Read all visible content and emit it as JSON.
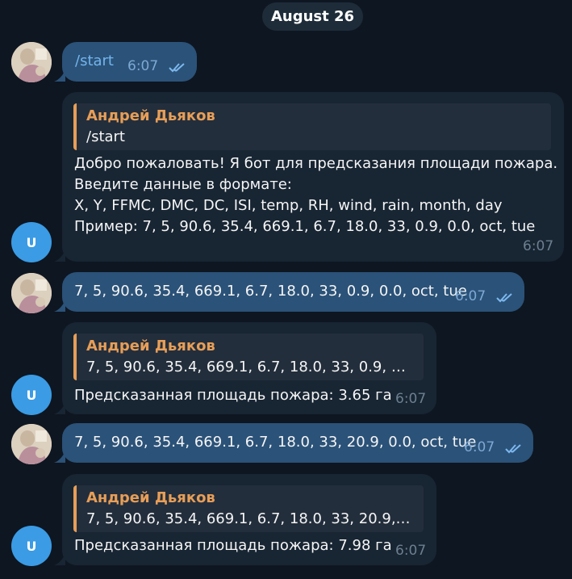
{
  "date_separator": "August 26",
  "messages": [
    {
      "text": "/start",
      "time": "6:07"
    },
    {
      "quote_author": "Андрей Дьяков",
      "quote_text": "/start",
      "lines": [
        "Добро пожаловать! Я бот для предсказания площади пожара.",
        "Введите данные в формате:",
        "X, Y, FFMC, DMC, DC, ISI, temp, RH, wind, rain, month, day",
        "Пример: 7, 5, 90.6, 35.4, 669.1, 6.7, 18.0, 33, 0.9, 0.0, oct, tue"
      ],
      "time": "6:07",
      "avatar_letter": "U"
    },
    {
      "text": "7, 5, 90.6, 35.4, 669.1, 6.7, 18.0, 33, 0.9, 0.0, oct, tue",
      "time": "6:07"
    },
    {
      "quote_author": "Андрей Дьяков",
      "quote_text": "7, 5, 90.6, 35.4, 669.1, 6.7, 18.0, 33, 0.9, 0.0, ...",
      "text": "Предсказанная площадь пожара: 3.65 га",
      "time": "6:07",
      "avatar_letter": "U"
    },
    {
      "text": "7, 5, 90.6, 35.4, 669.1, 6.7, 18.0, 33, 20.9, 0.0, oct, tue",
      "time": "6:07"
    },
    {
      "quote_author": "Андрей Дьяков",
      "quote_text": "7, 5, 90.6, 35.4, 669.1, 6.7, 18.0, 33, 20.9, 0.0...",
      "text": "Предсказанная площадь пожара: 7.98 га",
      "time": "6:07",
      "avatar_letter": "U"
    }
  ],
  "colors": {
    "background": "#0e1621",
    "outgoing_bubble": "#2b5278",
    "incoming_bubble": "#182533",
    "quote_accent": "#e79e57",
    "avatar_blue": "#3b9be4",
    "link": "#72b4ee"
  },
  "icons": {
    "read_receipt": "double-check-icon",
    "user_photo": "user-photo-avatar"
  }
}
